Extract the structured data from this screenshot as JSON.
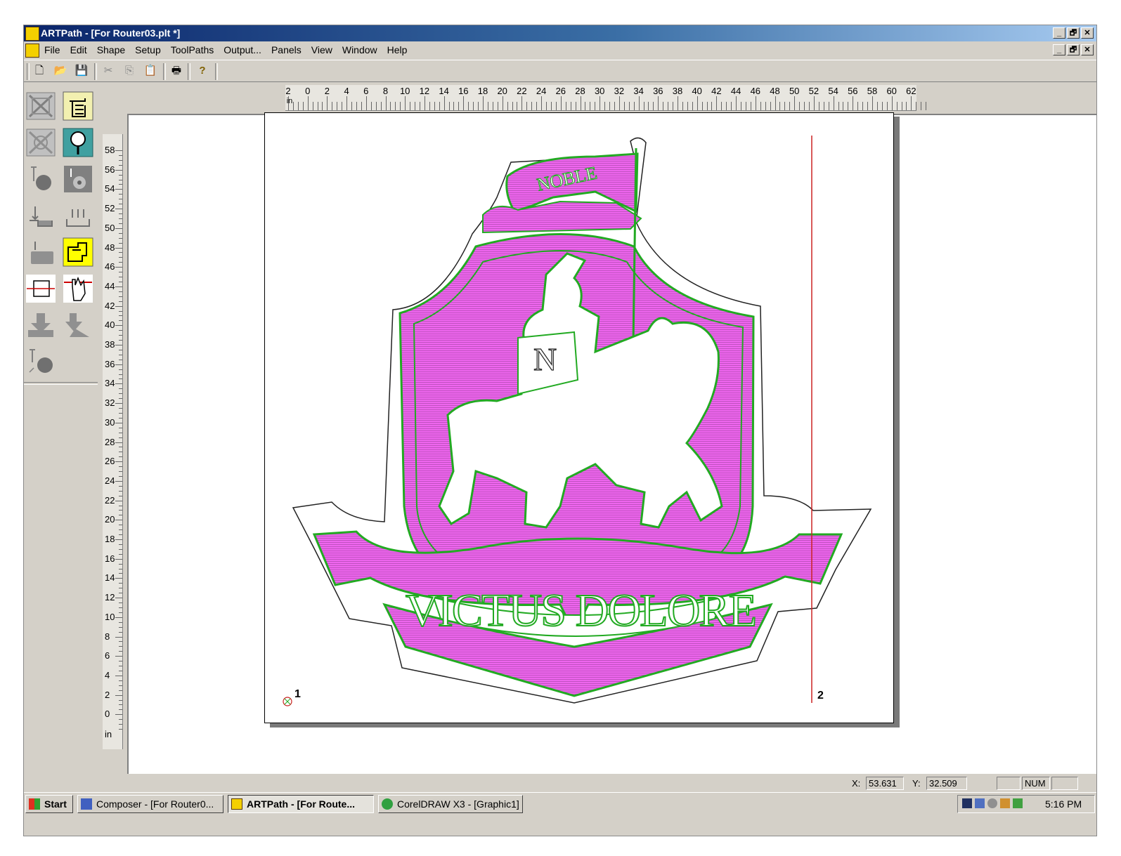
{
  "window": {
    "title": "ARTPath - [For Router03.plt *]",
    "app_icon": "artpath-app-icon",
    "caption_buttons": [
      "_",
      "🗗",
      "✕"
    ]
  },
  "menu": {
    "items": [
      "File",
      "Edit",
      "Shape",
      "Setup",
      "ToolPaths",
      "Output...",
      "Panels",
      "View",
      "Window",
      "Help"
    ]
  },
  "toolbar": {
    "buttons": [
      {
        "name": "new-document-icon",
        "glyph": "🗋"
      },
      {
        "name": "open-folder-icon",
        "glyph": "📂"
      },
      {
        "name": "save-disk-icon",
        "glyph": "💾"
      },
      {
        "name": "cut-scissors-icon",
        "glyph": "✂"
      },
      {
        "name": "copy-icon",
        "glyph": "⎘"
      },
      {
        "name": "paste-icon",
        "glyph": "📋"
      },
      {
        "name": "print-icon",
        "glyph": "🖶"
      },
      {
        "name": "help-icon",
        "glyph": "?"
      }
    ]
  },
  "horizontal_ruler": {
    "unit": "in",
    "labels": [
      "2",
      "0",
      "2",
      "4",
      "6",
      "8",
      "10",
      "12",
      "14",
      "16",
      "18",
      "20",
      "22",
      "24",
      "26",
      "28",
      "30",
      "32",
      "34",
      "36",
      "38",
      "40",
      "42",
      "44",
      "46",
      "48",
      "50",
      "52",
      "54",
      "56",
      "58",
      "60",
      "62"
    ]
  },
  "vertical_ruler": {
    "unit": "in",
    "labels": [
      "58",
      "56",
      "54",
      "52",
      "50",
      "48",
      "46",
      "44",
      "42",
      "40",
      "38",
      "36",
      "34",
      "32",
      "30",
      "28",
      "26",
      "24",
      "22",
      "20",
      "18",
      "16",
      "14",
      "12",
      "10",
      "8",
      "6",
      "4",
      "2",
      "0"
    ]
  },
  "drawing": {
    "banner_top_text": "NOBLE",
    "shield_letter": "N",
    "motto_text": "VICTUS DOLORE",
    "marker_1": "1",
    "marker_2": "2",
    "fill_color": "#ee66ee",
    "outline_color": "#22aa22",
    "cut_line_color": "#cc2222"
  },
  "status": {
    "x_label": "X:",
    "x_value": "53.631",
    "y_label": "Y:",
    "y_value": "32.509",
    "num": "NUM"
  },
  "taskbar": {
    "start_label": "Start",
    "tasks": [
      {
        "label": "Composer - [For Router0...",
        "active": false
      },
      {
        "label": "ARTPath - [For Route...",
        "active": true
      },
      {
        "label": "CorelDRAW X3 - [Graphic1]",
        "active": false
      }
    ],
    "clock": "5:16 PM"
  }
}
